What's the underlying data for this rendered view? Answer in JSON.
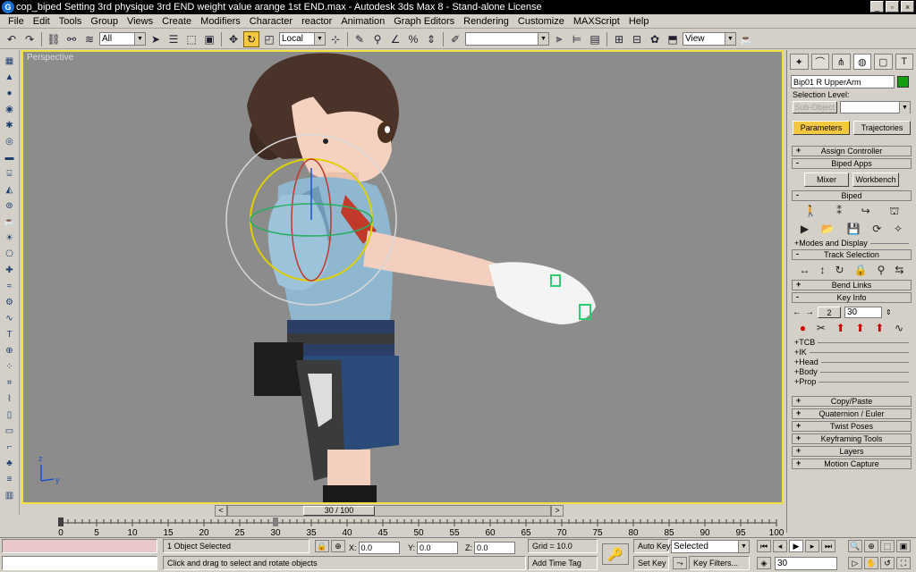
{
  "window": {
    "title": "cop_biped Setting 3rd physique 3rd END weight value arange 1st END.max - Autodesk 3ds Max 8 - Stand-alone License",
    "controls": [
      "_",
      "▫",
      "×"
    ]
  },
  "menu": [
    "File",
    "Edit",
    "Tools",
    "Group",
    "Views",
    "Create",
    "Modifiers",
    "Character",
    "reactor",
    "Animation",
    "Graph Editors",
    "Rendering",
    "Customize",
    "MAXScript",
    "Help"
  ],
  "toolbar": {
    "selection_filter": "All",
    "ref_coord": "Local",
    "named_selection": "",
    "render_view": "View"
  },
  "viewport": {
    "label": "Perspective"
  },
  "command_panel": {
    "object_name": "Bip01 R UpperArm",
    "object_color": "#12a012",
    "selection_level_label": "Selection Level:",
    "sub_object_label": "Sub-Object",
    "tab_parameters": "Parameters",
    "tab_trajectories": "Trajectories",
    "rollouts": {
      "assign_controller": "Assign Controller",
      "biped_apps": "Biped Apps",
      "mixer": "Mixer",
      "workbench": "Workbench",
      "biped": "Biped",
      "modes_display": "+Modes and Display",
      "track_selection": "Track Selection",
      "bend_links": "Bend Links",
      "key_info": "Key Info",
      "key_num": "2",
      "key_time": "30",
      "tcb": "+TCB",
      "ik": "+IK",
      "head": "+Head",
      "body": "+Body",
      "prop": "+Prop",
      "copy_paste": "Copy/Paste",
      "quaternion_euler": "Quaternion / Euler",
      "twist_poses": "Twist Poses",
      "keyframing_tools": "Keyframing Tools",
      "layers": "Layers",
      "motion_capture": "Motion Capture"
    }
  },
  "timeline": {
    "frame_label": "30 / 100",
    "current": 30,
    "max": 100,
    "ticks": [
      "0",
      "5",
      "10",
      "15",
      "20",
      "25",
      "30",
      "35",
      "40",
      "45",
      "50",
      "55",
      "60",
      "65",
      "70",
      "75",
      "80",
      "85",
      "90",
      "95",
      "100"
    ]
  },
  "status": {
    "selected": "1 Object Selected",
    "prompt": "Click and drag to select and rotate objects",
    "x": "0.0",
    "y": "0.0",
    "z": "0.0",
    "grid": "Grid = 10.0",
    "add_time_tag": "Add Time Tag",
    "auto_key": "Auto Key",
    "set_key": "Set Key",
    "selected_combo": "Selected",
    "key_filters": "Key Filters...",
    "frame": "30"
  }
}
